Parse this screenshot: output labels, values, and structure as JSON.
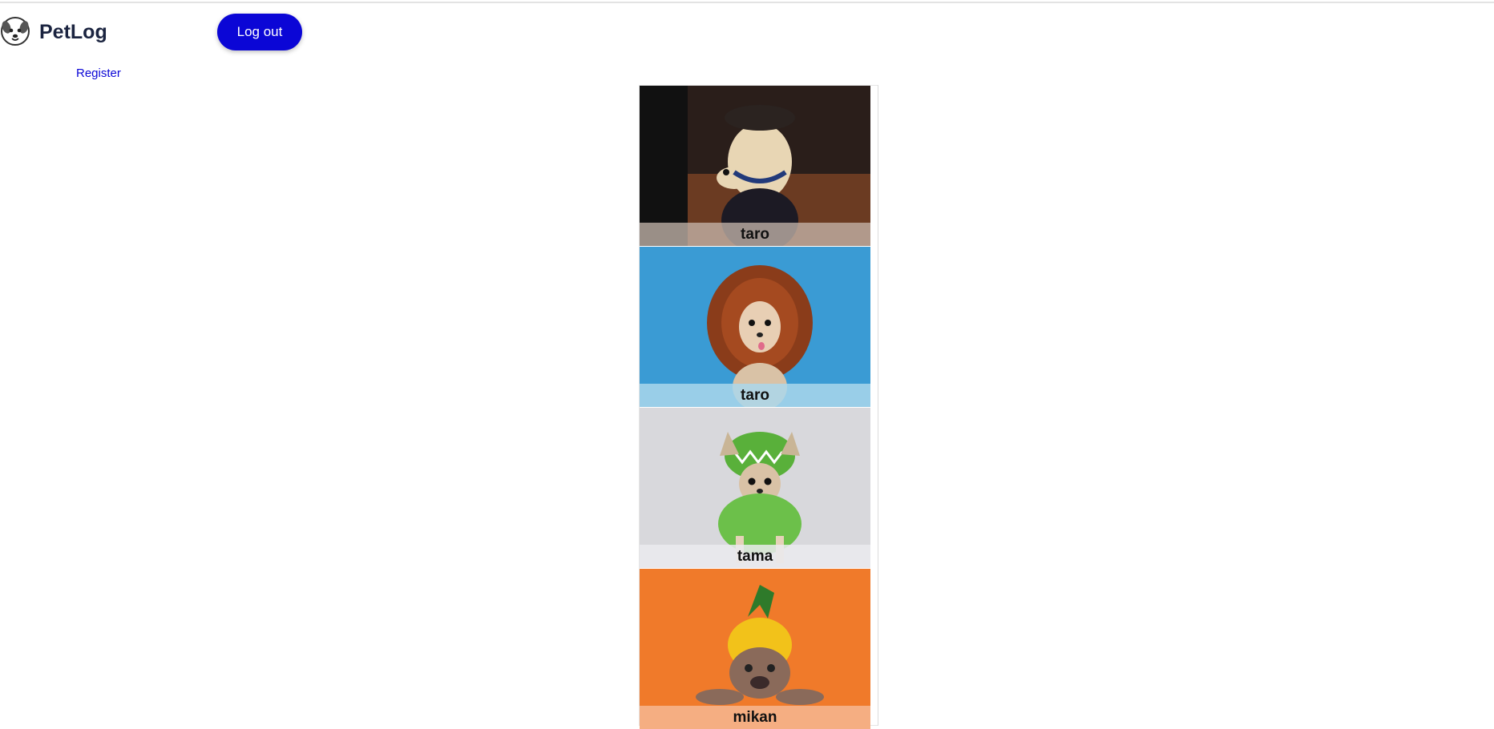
{
  "header": {
    "brand": "PetLog",
    "logout_label": "Log out",
    "register_label": "Register",
    "logo_icon": "dog-face-icon"
  },
  "feed": {
    "posts": [
      {
        "name": "taro",
        "photo": "dog in police hat and vest",
        "theme": "#3a2a22",
        "caption_bg": "rgba(200,185,175,0.75)"
      },
      {
        "name": "taro",
        "photo": "chihuahua in lion mane costume",
        "theme": "#3aa0d8",
        "caption_bg": "rgba(170,215,235,0.85)"
      },
      {
        "name": "tama",
        "photo": "chihuahua in green dinosaur hood",
        "theme": "#d8d8dc",
        "caption_bg": "rgba(235,235,238,0.85)"
      },
      {
        "name": "mikan",
        "photo": "bulldog in pineapple costume",
        "theme": "#f07a2a",
        "caption_bg": "rgba(245,180,140,0.9)"
      }
    ]
  },
  "colors": {
    "accent": "#0b06d6",
    "brand_text": "#1b2440"
  }
}
